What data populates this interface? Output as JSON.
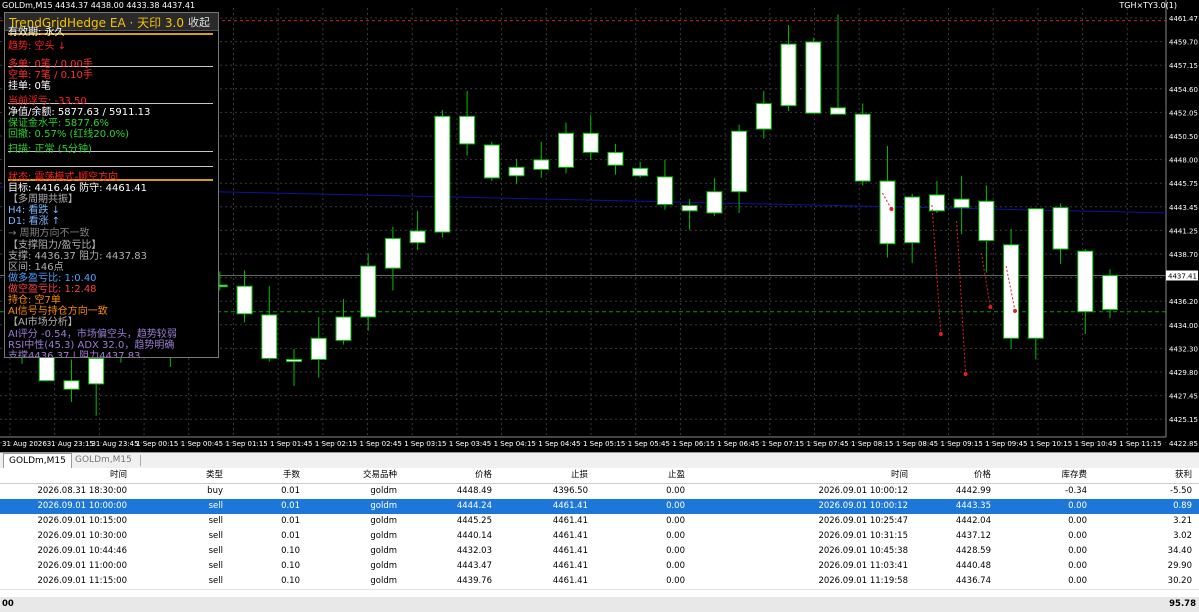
{
  "chart": {
    "symbol_title": "GOLDm,M15  4434.37 4438.00 4433.38 4437.41",
    "ea_tag": "TGH×TY3.0(1)",
    "price_labels": [
      "4461.47",
      "4459.70",
      "4457.15",
      "4454.60",
      "4452.05",
      "4450.50",
      "4448.00",
      "4445.75",
      "4443.45",
      "4441.25",
      "4438.70",
      "4437.41",
      "4436.20",
      "4434.00",
      "4432.30",
      "4429.80",
      "4427.45",
      "4425.15",
      "4422.85"
    ],
    "current_price": "4437.41",
    "time_labels": [
      "31 Aug 2026",
      "31 Aug 23:15",
      "31 Aug 23:45",
      "1 Sep 00:15",
      "1 Sep 00:45",
      "1 Sep 01:15",
      "1 Sep 01:45",
      "1 Sep 02:15",
      "1 Sep 02:45",
      "1 Sep 03:15",
      "1 Sep 03:45",
      "1 Sep 04:15",
      "1 Sep 04:45",
      "1 Sep 05:15",
      "1 Sep 05:45",
      "1 Sep 06:15",
      "1 Sep 06:45",
      "1 Sep 07:15",
      "1 Sep 07:45",
      "1 Sep 08:15",
      "1 Sep 08:45",
      "1 Sep 09:15",
      "1 Sep 09:45",
      "1 Sep 10:15",
      "1 Sep 10:45",
      "1 Sep 11:15"
    ],
    "colors": {
      "background": "#000000",
      "bull": "#ffffff",
      "bear": "#ffffff",
      "wick": "#00c000",
      "grid": "#2a2a2a",
      "stop_line": "#d02020",
      "ask_line": "#1010a0",
      "bid_line": "#00a000"
    },
    "candles": [
      {
        "o": 4431.8,
        "h": 4435.2,
        "l": 4429.1,
        "c": 4432.0
      },
      {
        "o": 4430.0,
        "h": 4433.5,
        "l": 4427.5,
        "c": 4427.5
      },
      {
        "o": 4427.5,
        "h": 4429.5,
        "l": 4425.5,
        "c": 4426.7
      },
      {
        "o": 4427.2,
        "h": 4431.2,
        "l": 4424.2,
        "c": 4429.6
      },
      {
        "o": 4430.3,
        "h": 4434.2,
        "l": 4429.2,
        "c": 4433.3
      },
      {
        "o": 4433.2,
        "h": 4435.0,
        "l": 4429.8,
        "c": 4430.9
      },
      {
        "o": 4430.9,
        "h": 4434.3,
        "l": 4428.8,
        "c": 4433.4
      },
      {
        "o": 4433.0,
        "h": 4437.2,
        "l": 4430.1,
        "c": 4436.4
      },
      {
        "o": 4436.5,
        "h": 4437.8,
        "l": 4436.0,
        "c": 4436.5
      },
      {
        "o": 4436.4,
        "h": 4437.9,
        "l": 4433.0,
        "c": 4433.8
      },
      {
        "o": 4433.7,
        "h": 4436.4,
        "l": 4429.3,
        "c": 4429.6
      },
      {
        "o": 4429.5,
        "h": 4430.5,
        "l": 4427.0,
        "c": 4429.3
      },
      {
        "o": 4429.5,
        "h": 4433.5,
        "l": 4427.8,
        "c": 4431.5
      },
      {
        "o": 4431.3,
        "h": 4435.2,
        "l": 4430.9,
        "c": 4433.5
      },
      {
        "o": 4433.5,
        "h": 4439.5,
        "l": 4432.2,
        "c": 4438.3
      },
      {
        "o": 4438.1,
        "h": 4442.0,
        "l": 4436.0,
        "c": 4440.9
      },
      {
        "o": 4440.5,
        "h": 4443.5,
        "l": 4439.8,
        "c": 4441.6
      },
      {
        "o": 4441.5,
        "h": 4453.0,
        "l": 4441.0,
        "c": 4452.4
      },
      {
        "o": 4452.4,
        "h": 4454.8,
        "l": 4448.7,
        "c": 4449.8
      },
      {
        "o": 4449.7,
        "h": 4450.0,
        "l": 4446.3,
        "c": 4446.6
      },
      {
        "o": 4446.8,
        "h": 4448.4,
        "l": 4446.0,
        "c": 4447.6
      },
      {
        "o": 4447.4,
        "h": 4450.0,
        "l": 4446.6,
        "c": 4448.3
      },
      {
        "o": 4447.6,
        "h": 4451.8,
        "l": 4447.0,
        "c": 4450.8
      },
      {
        "o": 4450.8,
        "h": 4452.5,
        "l": 4448.3,
        "c": 4449.0
      },
      {
        "o": 4449.0,
        "h": 4449.8,
        "l": 4446.9,
        "c": 4447.8
      },
      {
        "o": 4447.5,
        "h": 4448.1,
        "l": 4446.6,
        "c": 4446.8
      },
      {
        "o": 4446.7,
        "h": 4448.3,
        "l": 4443.6,
        "c": 4444.1
      },
      {
        "o": 4444.0,
        "h": 4444.6,
        "l": 4441.7,
        "c": 4443.5
      },
      {
        "o": 4443.3,
        "h": 4446.6,
        "l": 4443.0,
        "c": 4445.3
      },
      {
        "o": 4445.3,
        "h": 4451.6,
        "l": 4443.3,
        "c": 4451.0
      },
      {
        "o": 4451.2,
        "h": 4454.8,
        "l": 4450.3,
        "c": 4453.6
      },
      {
        "o": 4453.4,
        "h": 4461.0,
        "l": 4452.9,
        "c": 4459.2
      },
      {
        "o": 4459.4,
        "h": 4459.8,
        "l": 4452.7,
        "c": 4452.7
      },
      {
        "o": 4453.2,
        "h": 4462.0,
        "l": 4452.6,
        "c": 4452.6
      },
      {
        "o": 4452.6,
        "h": 4453.6,
        "l": 4445.9,
        "c": 4446.3
      },
      {
        "o": 4446.3,
        "h": 4449.6,
        "l": 4439.1,
        "c": 4440.4
      },
      {
        "o": 4440.5,
        "h": 4445.1,
        "l": 4438.6,
        "c": 4444.8
      },
      {
        "o": 4445.0,
        "h": 4446.3,
        "l": 4443.3,
        "c": 4443.5
      },
      {
        "o": 4443.8,
        "h": 4446.8,
        "l": 4441.3,
        "c": 4444.6
      },
      {
        "o": 4444.4,
        "h": 4445.9,
        "l": 4437.7,
        "c": 4440.7
      },
      {
        "o": 4440.3,
        "h": 4441.8,
        "l": 4430.5,
        "c": 4431.5
      },
      {
        "o": 4431.5,
        "h": 4443.7,
        "l": 4429.5,
        "c": 4443.7
      },
      {
        "o": 4443.8,
        "h": 4444.2,
        "l": 4438.5,
        "c": 4439.9
      },
      {
        "o": 4439.7,
        "h": 4439.9,
        "l": 4431.9,
        "c": 4434.0
      },
      {
        "o": 4434.2,
        "h": 4438.0,
        "l": 4433.4,
        "c": 4437.4
      }
    ],
    "stop_level": 4461.41,
    "ask_level": 4445.75,
    "bid_level": 4434.0,
    "current_level": 4437.41
  },
  "panel": {
    "title": "TrendGridHedge EA · 天印 3.0",
    "collapse": "收起",
    "lines": [
      {
        "text": "有效期: 永久",
        "color": "#ffffff"
      },
      {
        "text": "趋势: 空头 ↓",
        "color": "#ff2020"
      },
      {
        "text": "多单: 0笔 / 0.00手",
        "color": "#ff3030"
      },
      {
        "text": "空单: 7笔 / 0.10手",
        "color": "#ff3030"
      },
      {
        "text": "挂单: 0笔",
        "color": "#ffffff"
      },
      {
        "text": "当前浮亏: -33.50",
        "color": "#ff2020"
      },
      {
        "text": "净值/余额: 5877.63 / 5911.13",
        "color": "#ffffff"
      },
      {
        "text": "保证金水平: 5877.6%",
        "color": "#2bd42b"
      },
      {
        "text": "回撤: 0.57% (红线20.0%)",
        "color": "#2bd42b"
      },
      {
        "text": "扫描: 正常 (5分钟)",
        "color": "#2bd42b"
      },
      {
        "text": "状态: 震荡模式-顺空方向",
        "color": "#ff2020"
      },
      {
        "text": "目标: 4416.46  防守: 4461.41",
        "color": "#ffffff"
      },
      {
        "text": "【多周期共振】",
        "color": "#b0b0b0"
      },
      {
        "text": "H4: 看跌 ↓",
        "color": "#7ab8ff"
      },
      {
        "text": "D1: 看涨 ↑",
        "color": "#7ab8ff"
      },
      {
        "text": "→ 周期方向不一致",
        "color": "#808080"
      },
      {
        "text": "【支撑阻力/盈亏比】",
        "color": "#b0b0b0"
      },
      {
        "text": "支撑: 4436.37  阻力: 4437.83",
        "color": "#b0b0b0"
      },
      {
        "text": "区间: 146点",
        "color": "#b0b0b0"
      },
      {
        "text": "做多盈亏比: 1:0.40",
        "color": "#4aa0ff"
      },
      {
        "text": "做空盈亏比: 1:2.48",
        "color": "#ff4040"
      },
      {
        "text": "持仓: 空7单",
        "color": "#ff8c00"
      },
      {
        "text": "AI信号与持仓方向一致",
        "color": "#ff8c00"
      },
      {
        "text": "【AI市场分析】",
        "color": "#b0b0b0"
      },
      {
        "text": "AI评分 -0.54，市场偏空头，趋势较弱",
        "color": "#9b7dd4"
      },
      {
        "text": "RSI中性(45.3) ADX 32.0，趋势明确",
        "color": "#9b7dd4"
      },
      {
        "text": "支撑4436.37 | 阻力4437.83",
        "color": "#9b7dd4"
      }
    ]
  },
  "tabs": [
    {
      "label": "GOLDm,M15",
      "active": true
    },
    {
      "label": "GOLDm,M15",
      "active": false
    }
  ],
  "table": {
    "headers": [
      "时间",
      "类型",
      "手数",
      "交易品种",
      "价格",
      "止损",
      "止盈",
      "时间",
      "价格",
      "库存费",
      "获利"
    ],
    "rows": [
      [
        "2026.08.31 18:30:00",
        "buy",
        "0.01",
        "goldm",
        "4448.49",
        "4396.50",
        "0.00",
        "2026.09.01 10:00:12",
        "4442.99",
        "-0.34",
        "-5.50"
      ],
      [
        "2026.09.01 10:00:00",
        "sell",
        "0.01",
        "goldm",
        "4444.24",
        "4461.41",
        "0.00",
        "2026.09.01 10:00:12",
        "4443.35",
        "0.00",
        "0.89"
      ],
      [
        "2026.09.01 10:15:00",
        "sell",
        "0.01",
        "goldm",
        "4445.25",
        "4461.41",
        "0.00",
        "2026.09.01 10:25:47",
        "4442.04",
        "0.00",
        "3.21"
      ],
      [
        "2026.09.01 10:30:00",
        "sell",
        "0.01",
        "goldm",
        "4440.14",
        "4461.41",
        "0.00",
        "2026.09.01 10:31:15",
        "4437.12",
        "0.00",
        "3.02"
      ],
      [
        "2026.09.01 10:44:46",
        "sell",
        "0.10",
        "goldm",
        "4432.03",
        "4461.41",
        "0.00",
        "2026.09.01 10:45:38",
        "4428.59",
        "0.00",
        "34.40"
      ],
      [
        "2026.09.01 11:00:00",
        "sell",
        "0.10",
        "goldm",
        "4443.47",
        "4461.41",
        "0.00",
        "2026.09.01 11:03:41",
        "4440.48",
        "0.00",
        "29.90"
      ],
      [
        "2026.09.01 11:15:00",
        "sell",
        "0.10",
        "goldm",
        "4439.76",
        "4461.41",
        "0.00",
        "2026.09.01 11:19:58",
        "4436.74",
        "0.00",
        "30.20"
      ]
    ],
    "selected_row": 1,
    "footer_left": "00",
    "footer_total": "95.78"
  }
}
